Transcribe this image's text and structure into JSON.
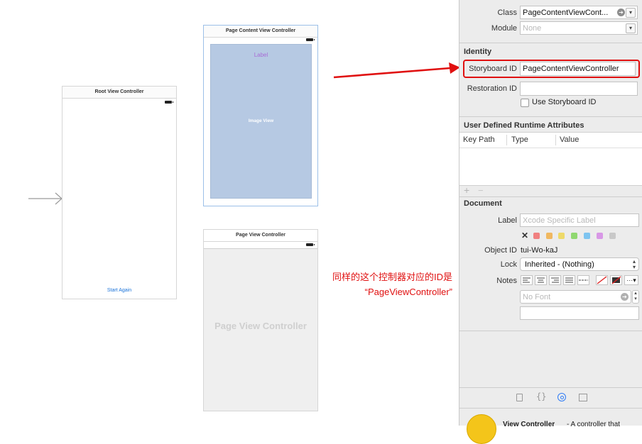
{
  "canvas": {
    "root_scene": {
      "title": "Root View Controller",
      "button_label": "Start Again"
    },
    "content_scene": {
      "title": "Page Content View Controller",
      "label_text": "Label",
      "image_view_text": "Image View"
    },
    "page_scene": {
      "title": "Page View Controller",
      "watermark": "Page View Controller"
    },
    "annotation": {
      "line1": "同样的这个控制器对应的ID是",
      "line2": "“PageViewController”"
    }
  },
  "inspector": {
    "class_label": "Class",
    "class_value": "PageContentViewCont...",
    "module_label": "Module",
    "module_placeholder": "None",
    "identity_header": "Identity",
    "storyboard_id_label": "Storyboard ID",
    "storyboard_id_value": "PageContentViewController",
    "restoration_id_label": "Restoration ID",
    "restoration_id_value": "",
    "use_storyboard_id_label": "Use Storyboard ID",
    "runtime_attrs_header": "User Defined Runtime Attributes",
    "runtime_columns": [
      "Key Path",
      "Type",
      "Value"
    ],
    "add_symbol": "+",
    "remove_symbol": "−",
    "document_header": "Document",
    "doc_label_label": "Label",
    "doc_label_placeholder": "Xcode Specific Label",
    "object_id_label": "Object ID",
    "object_id_value": "tui-Wo-kaJ",
    "lock_label": "Lock",
    "lock_value": "Inherited - (Nothing)",
    "notes_label": "Notes",
    "font_placeholder": "No Font",
    "library_item_title": "View Controller",
    "library_item_desc": "- A controller that"
  },
  "colors": {
    "swatches": [
      "#f08080",
      "#f0b860",
      "#eeda6a",
      "#90d870",
      "#7ec4f0",
      "#d898e6",
      "#c8c8c8"
    ],
    "annotation_red": "#e01010",
    "image_view_fill": "#b6c9e3",
    "label_purple": "#a86cd6",
    "link_blue": "#1a73d9"
  }
}
